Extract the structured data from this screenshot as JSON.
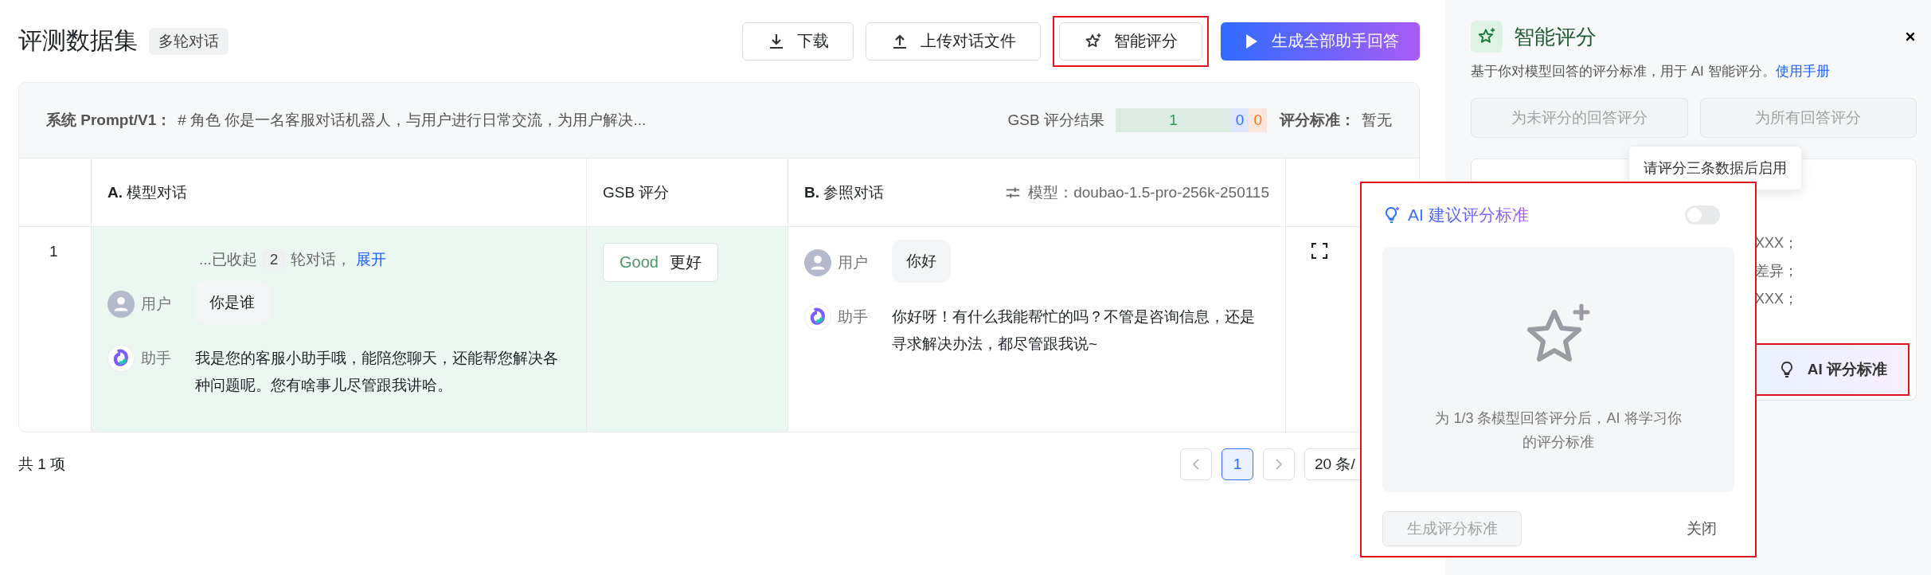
{
  "page": {
    "title": "评测数据集",
    "tag": "多轮对话"
  },
  "toolbar": [
    {
      "kind": "download",
      "label": "下载",
      "highlighted": false
    },
    {
      "kind": "upload",
      "label": "上传对话文件",
      "highlighted": false
    },
    {
      "kind": "smart",
      "label": "智能评分",
      "highlighted": true
    },
    {
      "kind": "generate",
      "label": "生成全部助手回答",
      "highlighted": false
    }
  ],
  "summary": {
    "prompt_label": "系统 Prompt/V1：",
    "prompt_text": "# 角色 你是一名客服对话机器人，与用户进行日常交流，为用户解决...",
    "gsb_label": "GSB 评分结果",
    "gsb_segments": [
      {
        "label": "1",
        "color": "#2e9a4f"
      },
      {
        "label": "0",
        "color": "#3370ff"
      },
      {
        "label": "0",
        "color": "#f5771f"
      }
    ],
    "standard_label": "评分标准：",
    "standard_value": "暂无"
  },
  "table": {
    "columns": [
      "**A.** 模型对话",
      "GSB 评分",
      "**B.** 参照对话"
    ],
    "model_label": "模型：doubao-1.5-pro-256k-250115",
    "rows": [
      {
        "index": "1",
        "a_better": true,
        "collapsed": {
          "prefix": "...已收起",
          "count": "2",
          "suffix": "轮对话，",
          "link": "展开"
        },
        "a_messages": [
          {
            "kind": "user",
            "name": "用户",
            "text": "你是谁"
          },
          {
            "kind": "assistant",
            "name": "助手",
            "text": "我是您的客服小助手哦，能陪您聊天，还能帮您解决各种问题呢。您有啥事儿尽管跟我讲哈。"
          }
        ],
        "gsb": {
          "tag": "Good",
          "label": "更好"
        },
        "b_messages": [
          {
            "kind": "user",
            "name": "用户",
            "text": "你好"
          },
          {
            "kind": "assistant",
            "name": "助手",
            "text": "你好呀！有什么我能帮忙的吗？不管是咨询信息，还是寻求解决办法，都尽管跟我说~"
          }
        ]
      }
    ]
  },
  "pagination": {
    "total": "共 1 项",
    "pages": [
      {
        "label": "1",
        "selected": true
      }
    ],
    "page_size": "20 条/"
  },
  "panel": {
    "title": "智能评分",
    "description": "基于你对模型回答的评分标准，用于 AI 智能评分。",
    "manual_link": "使用手册",
    "actions": [
      {
        "label": "为未评分的回答评分",
        "disabled": true
      },
      {
        "label": "为所有回答评分",
        "disabled": true
      }
    ],
    "tooltip": "请评分三条数据后启用",
    "criteria_lines": [
      "XXX；",
      "差异；",
      "XXX；"
    ],
    "ai_button": {
      "label": "AI 评分标准",
      "highlighted": true
    }
  },
  "popover": {
    "title": "AI 建议评分标准",
    "toggle_on": false,
    "hint": "为 1/3 条模型回答评分后，AI 将学习你的评分标准",
    "generate": {
      "label": "生成评分标准",
      "disabled": true
    },
    "close": "关闭",
    "highlighted": true
  }
}
